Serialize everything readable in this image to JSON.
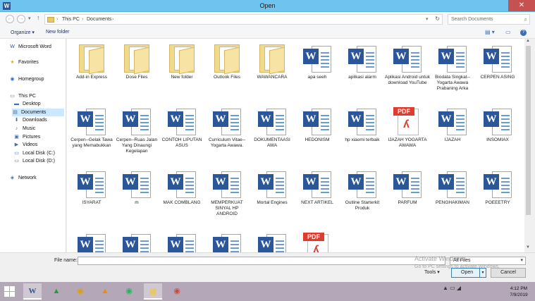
{
  "window": {
    "title": "Open",
    "close_glyph": "✕",
    "app_icon_letter": "W"
  },
  "nav": {
    "back_glyph": "←",
    "forward_glyph": "→",
    "dropdown_glyph": "▾",
    "up_glyph": "↑",
    "breadcrumb": [
      "This PC",
      "Documents"
    ],
    "sep": "›",
    "refresh_glyph": "↻",
    "search_placeholder": "Search Documents",
    "search_icon": "⌕"
  },
  "toolbar": {
    "organize": "Organize ▾",
    "new_folder": "New folder",
    "view_glyph": "▤ ▾",
    "pane_glyph": "▭",
    "help_glyph": "?"
  },
  "sidebar": {
    "items": [
      {
        "label": "Microsoft Word",
        "icon": "W",
        "icon_name": "word-icon"
      },
      {
        "label": "Favorites",
        "icon": "★",
        "icon_name": "star-icon"
      },
      {
        "label": "Homegroup",
        "icon": "◉",
        "icon_name": "homegroup-icon"
      },
      {
        "label": "This PC",
        "icon": "▭",
        "icon_name": "computer-icon"
      },
      {
        "label": "Desktop",
        "icon": "▬",
        "icon_name": "desktop-icon"
      },
      {
        "label": "Documents",
        "icon": "▤",
        "icon_name": "documents-icon"
      },
      {
        "label": "Downloads",
        "icon": "⬇",
        "icon_name": "downloads-icon"
      },
      {
        "label": "Music",
        "icon": "♪",
        "icon_name": "music-icon"
      },
      {
        "label": "Pictures",
        "icon": "▣",
        "icon_name": "pictures-icon"
      },
      {
        "label": "Videos",
        "icon": "▶",
        "icon_name": "videos-icon"
      },
      {
        "label": "Local Disk (C:)",
        "icon": "▭",
        "icon_name": "disk-icon"
      },
      {
        "label": "Local Disk (D:)",
        "icon": "▭",
        "icon_name": "disk-icon"
      },
      {
        "label": "Network",
        "icon": "◈",
        "icon_name": "network-icon"
      }
    ]
  },
  "files": [
    {
      "name": "Add-in Express",
      "type": "folder"
    },
    {
      "name": "Dose Files",
      "type": "folder"
    },
    {
      "name": "New folder",
      "type": "folder"
    },
    {
      "name": "Outlook Files",
      "type": "folder"
    },
    {
      "name": "WAWANCARA",
      "type": "folder"
    },
    {
      "name": "apa seeh",
      "type": "word"
    },
    {
      "name": "aplikasi alarm",
      "type": "word"
    },
    {
      "name": "Aplikasi Android untuk download YouTube",
      "type": "word"
    },
    {
      "name": "Biodata Singkat--Yogarta Awawa Prabaning Arka",
      "type": "word"
    },
    {
      "name": "CERPEN ASING",
      "type": "word"
    },
    {
      "name": "Cerpen--Gelak Tawa yang Memabukkan",
      "type": "word"
    },
    {
      "name": "Cerpen--Ruas Jalan Yang Dinaungi Kegelapan",
      "type": "word"
    },
    {
      "name": "CONTOH LIPUTAN ASUS",
      "type": "word"
    },
    {
      "name": "Curriculum Vitae--Yogarta Awawa.",
      "type": "word"
    },
    {
      "name": "DOKUMENTAASI AWA",
      "type": "word"
    },
    {
      "name": "HEDONISM",
      "type": "word"
    },
    {
      "name": "hp xiaomi terbaik",
      "type": "word"
    },
    {
      "name": "IJAZAH YOGARTA AWAWA",
      "type": "pdf"
    },
    {
      "name": "IJAZAH",
      "type": "word"
    },
    {
      "name": "INSOMIAX",
      "type": "word"
    },
    {
      "name": "ISYARAT",
      "type": "word"
    },
    {
      "name": "m",
      "type": "word"
    },
    {
      "name": "MAK COMBLANG",
      "type": "word"
    },
    {
      "name": "MEMPERKUAT SINYAL HP ANDROID",
      "type": "word"
    },
    {
      "name": "Mortal Engines",
      "type": "word"
    },
    {
      "name": "NEXT ARTIKEL",
      "type": "word"
    },
    {
      "name": "Outline Starterkit Produk",
      "type": "word"
    },
    {
      "name": "PARFUM",
      "type": "word"
    },
    {
      "name": "PENGHAKIMAN",
      "type": "word"
    },
    {
      "name": "POEEETRY",
      "type": "word"
    },
    {
      "name": "",
      "type": "word"
    },
    {
      "name": "",
      "type": "word"
    },
    {
      "name": "",
      "type": "word"
    },
    {
      "name": "",
      "type": "word"
    },
    {
      "name": "",
      "type": "word"
    },
    {
      "name": "",
      "type": "pdf"
    }
  ],
  "file_icons": {
    "word_letter": "W",
    "pdf_tag": "PDF",
    "pdf_swirl": "ʎ"
  },
  "bottom": {
    "file_name_label": "File name:",
    "file_name_value": "",
    "file_type": "All Files",
    "tools": "Tools ▾",
    "open": "Open",
    "open_arrow": "▾",
    "cancel": "Cancel"
  },
  "watermark": {
    "line1": "Activate Windows",
    "line2": "Go to PC settings to activate Windows."
  },
  "taskbar": {
    "apps": [
      {
        "name": "word-taskbar-icon",
        "glyph": "W",
        "color": "#2b579a",
        "active": true
      },
      {
        "name": "triangle-app-icon",
        "glyph": "▲",
        "color": "#1fa13a",
        "active": false
      },
      {
        "name": "chrome-icon",
        "glyph": "◉",
        "color": "#e0a100",
        "active": false
      },
      {
        "name": "vlc-icon",
        "glyph": "▲",
        "color": "#f08a00",
        "active": false
      },
      {
        "name": "spotify-icon",
        "glyph": "◉",
        "color": "#1db954",
        "active": false
      },
      {
        "name": "explorer-icon",
        "glyph": "▆",
        "color": "#e8c96a",
        "active": true
      },
      {
        "name": "chrome-icon-2",
        "glyph": "◉",
        "color": "#d44638",
        "active": false
      }
    ],
    "tray": "▲ ▭ ◢",
    "time": "4:12 PM",
    "date": "7/9/2019"
  }
}
